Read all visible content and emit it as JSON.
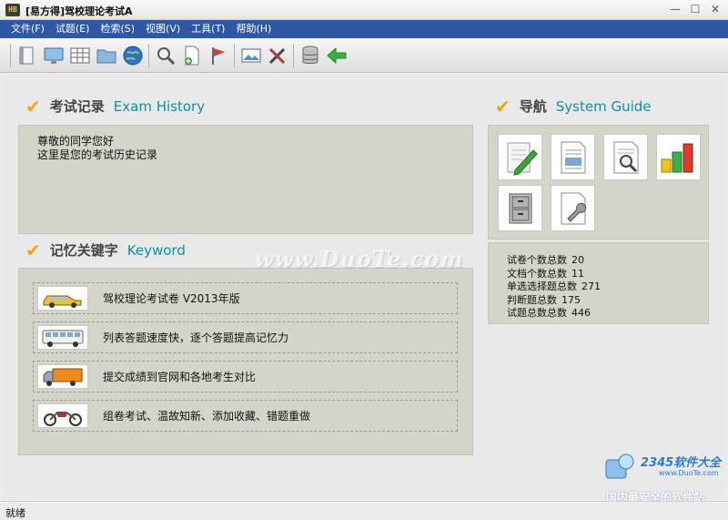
{
  "window": {
    "title": "[易方得]驾校理论考试A",
    "app_icon_text": "HB",
    "controls": [
      "—",
      "☐",
      "✕"
    ]
  },
  "menu": [
    {
      "label": "文件(F)"
    },
    {
      "label": "试题(E)"
    },
    {
      "label": "检索(S)"
    },
    {
      "label": "视图(V)"
    },
    {
      "label": "工具(T)"
    },
    {
      "label": "帮助(H)"
    }
  ],
  "toolbar": {
    "buttons": [
      {
        "icon": "book-icon"
      },
      {
        "icon": "monitor-icon"
      },
      {
        "icon": "table-icon"
      },
      {
        "icon": "folder-icon"
      },
      {
        "icon": "globe-icon"
      },
      {
        "icon": "search-icon"
      },
      {
        "icon": "new-document-icon"
      },
      {
        "icon": "flag-icon"
      },
      {
        "icon": "picture-icon"
      },
      {
        "icon": "tools-icon"
      },
      {
        "icon": "database-icon"
      },
      {
        "icon": "back-arrow-icon"
      }
    ]
  },
  "history": {
    "title_cn": "考试记录",
    "title_en": "Exam History",
    "lines": [
      "尊敬的同学您好",
      "这里是您的考试历史记录"
    ]
  },
  "keyword": {
    "title_cn": "记忆关键字",
    "title_en": "Keyword",
    "items": [
      {
        "icon": "taxi-icon",
        "text": "驾校理论考试卷 V2013年版"
      },
      {
        "icon": "bus-icon",
        "text": "列表答题速度快，逐个答题提高记忆力"
      },
      {
        "icon": "truck-icon",
        "text": "提交成绩到官网和各地考生对比"
      },
      {
        "icon": "motorcycle-icon",
        "text": "组卷考试、温故知新、添加收藏、错题重做"
      }
    ]
  },
  "guide": {
    "title_cn": "导航",
    "title_en": "System Guide",
    "tiles": [
      {
        "icon": "edit-pencil-icon"
      },
      {
        "icon": "document-icon"
      },
      {
        "icon": "document-search-icon"
      },
      {
        "icon": "bar-chart-icon"
      },
      {
        "icon": "cabinet-icon"
      },
      {
        "icon": "document-settings-icon"
      }
    ]
  },
  "stats": [
    {
      "label": "试卷个数总数",
      "value": "20"
    },
    {
      "label": "文档个数总数",
      "value": "11"
    },
    {
      "label": "单选选择题总数",
      "value": "271"
    },
    {
      "label": "判断题总数",
      "value": "175"
    },
    {
      "label": "试题总数总数",
      "value": "446"
    }
  ],
  "watermark": {
    "text": "www.DuoTe.com",
    "brand_name": "2345软件大全",
    "brand_url": "www.DuoTe.com",
    "brand_slogan": "国内最安全的软件站"
  },
  "status": {
    "text": "就绪"
  },
  "colors": {
    "menubar": "#2e57a6",
    "accent_en": "#0e8fa7",
    "check": "#f3a311",
    "panel": "#d4d4c8"
  }
}
